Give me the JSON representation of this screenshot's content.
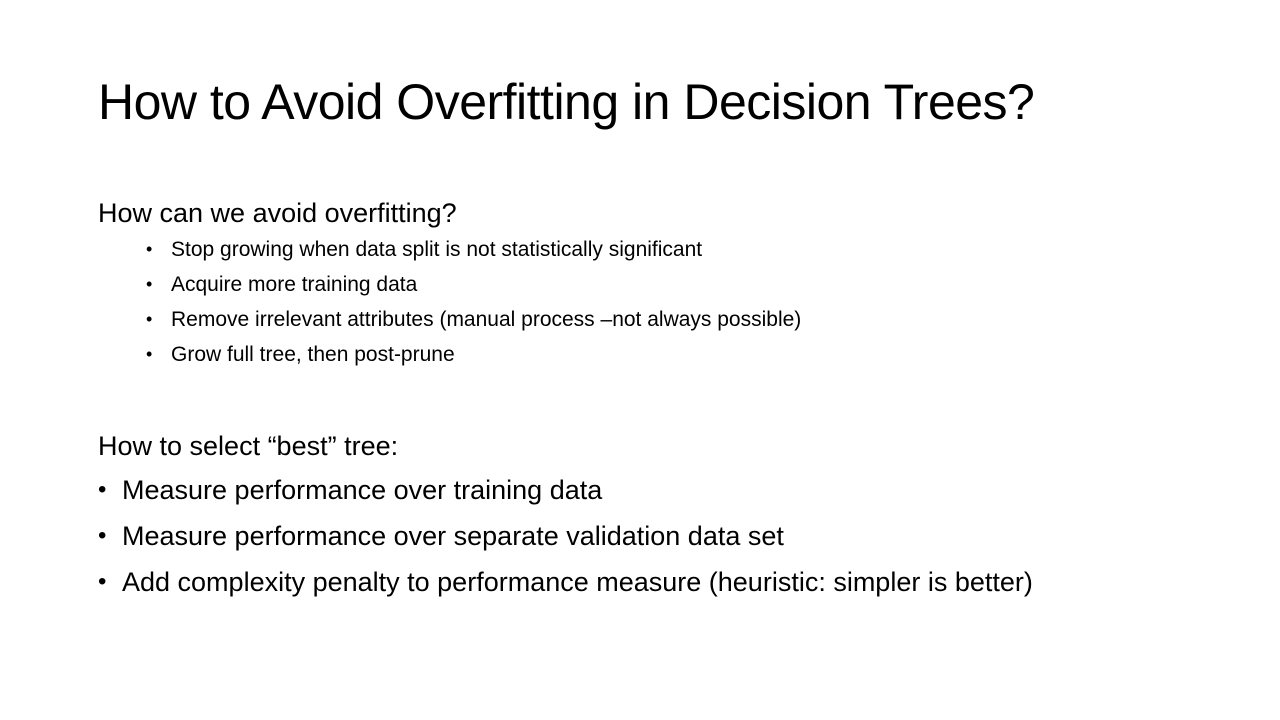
{
  "slide": {
    "title": "How to Avoid Overfitting in Decision Trees?",
    "section1": {
      "heading": "How can we avoid overfitting?",
      "bullets": [
        "Stop growing when data split is not statistically significant",
        "Acquire more training data",
        "Remove irrelevant attributes (manual process –not always possible)",
        "Grow full tree, then post-prune"
      ]
    },
    "section2": {
      "heading": "How to select “best” tree:",
      "bullets": [
        "Measure performance over training data",
        "Measure performance over separate validation data set",
        "Add complexity penalty to performance measure (heuristic: simpler is better)"
      ]
    }
  }
}
